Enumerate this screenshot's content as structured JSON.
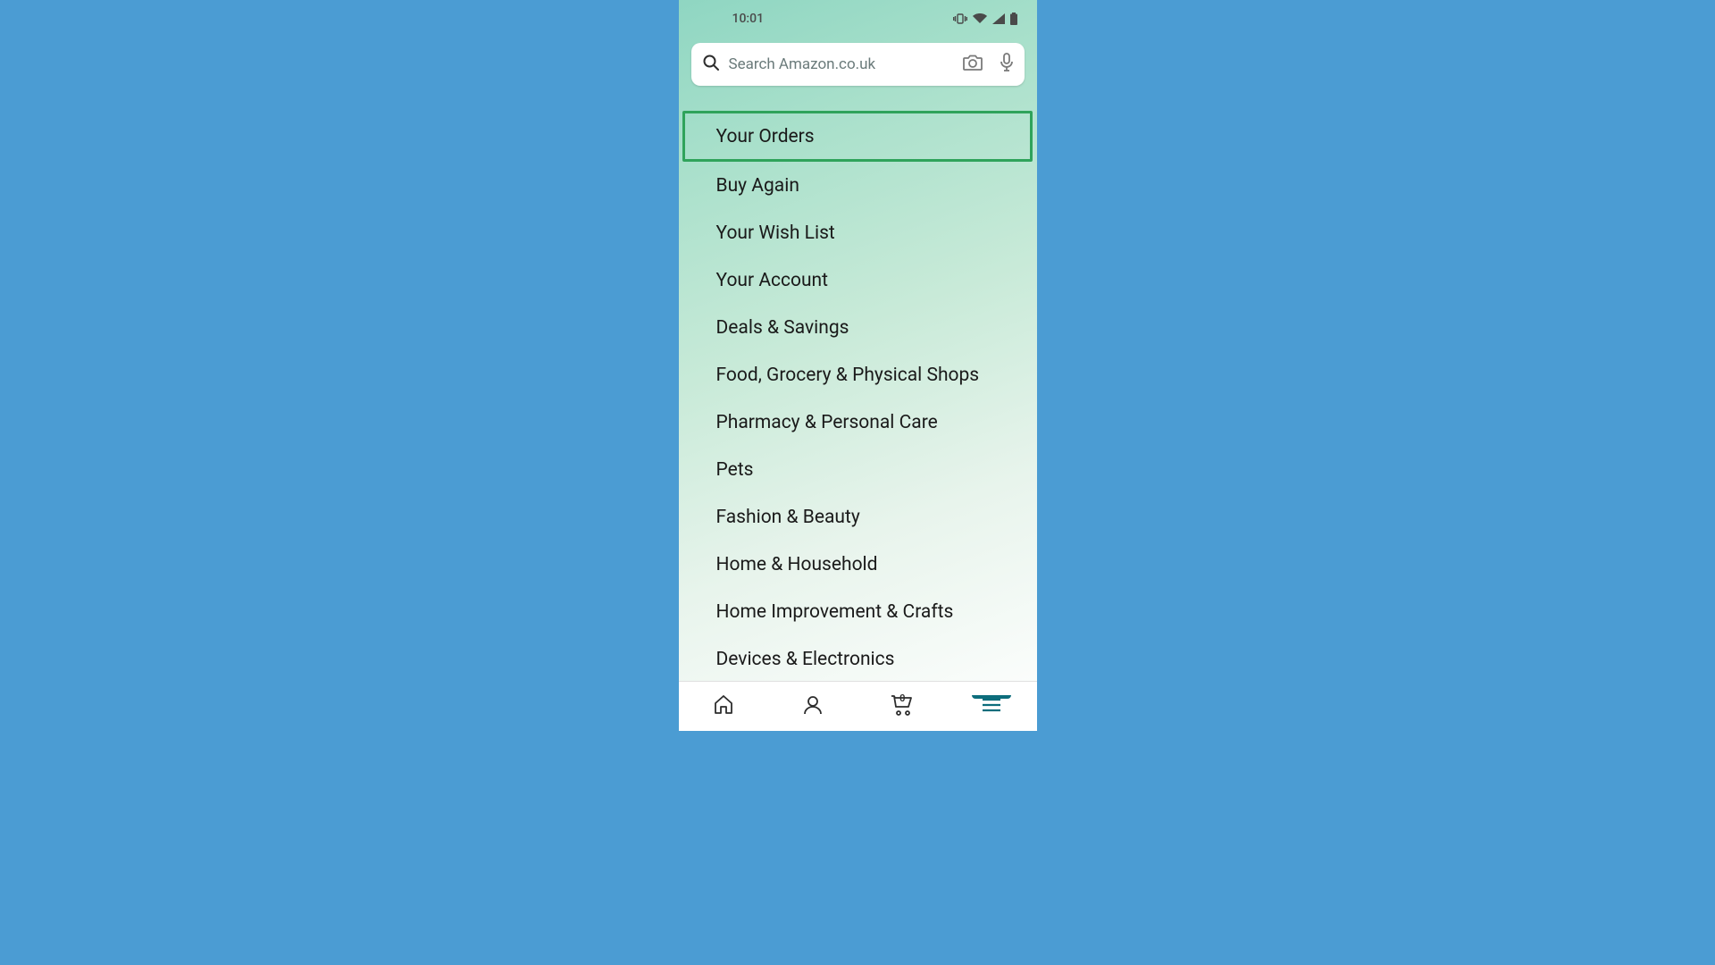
{
  "status": {
    "time": "10:01"
  },
  "search": {
    "placeholder": "Search Amazon.co.uk"
  },
  "menu": {
    "items": [
      {
        "label": "Your Orders",
        "highlighted": true
      },
      {
        "label": "Buy Again",
        "highlighted": false
      },
      {
        "label": "Your Wish List",
        "highlighted": false
      },
      {
        "label": "Your Account",
        "highlighted": false
      },
      {
        "label": "Deals & Savings",
        "highlighted": false
      },
      {
        "label": "Food, Grocery & Physical Shops",
        "highlighted": false
      },
      {
        "label": "Pharmacy & Personal Care",
        "highlighted": false
      },
      {
        "label": "Pets",
        "highlighted": false
      },
      {
        "label": "Fashion & Beauty",
        "highlighted": false
      },
      {
        "label": "Home & Household",
        "highlighted": false
      },
      {
        "label": "Home Improvement & Crafts",
        "highlighted": false
      },
      {
        "label": "Devices & Electronics",
        "highlighted": false
      }
    ]
  },
  "nav": {
    "cart_count": "0",
    "active": "menu"
  }
}
